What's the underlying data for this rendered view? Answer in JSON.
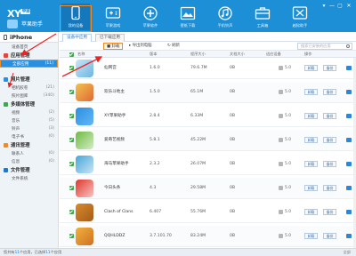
{
  "app": {
    "logo_text": "XY",
    "logo_badge": "苹果",
    "logo_subtitle": "苹果助手"
  },
  "nav": [
    {
      "label": "我的设备",
      "icon": "phone-icon",
      "active": true
    },
    {
      "label": "苹果游戏",
      "icon": "gamepad-icon"
    },
    {
      "label": "苹果软件",
      "icon": "plus-icon"
    },
    {
      "label": "壁纸下载",
      "icon": "image-icon"
    },
    {
      "label": "手机铃声",
      "icon": "bell-icon"
    },
    {
      "label": "工具箱",
      "icon": "briefcase-icon"
    },
    {
      "label": "越狱助手",
      "icon": "jailbreak-icon"
    }
  ],
  "window_controls": [
    "▾",
    "—",
    "▢",
    "✕"
  ],
  "sidebar": {
    "device": "iPhone",
    "device_sub": "设备首页",
    "sections": [
      {
        "title": "应用管理",
        "color": "#e2453c",
        "items": [
          {
            "label": "全部应用",
            "count": "(11)",
            "selected": true
          }
        ]
      },
      {
        "title": "照片管理",
        "color": "#2b8fe0",
        "items": [
          {
            "label": "相机胶卷",
            "count": "(21)"
          },
          {
            "label": "照片图库",
            "count": "(340)"
          }
        ]
      },
      {
        "title": "多媒体管理",
        "color": "#3fa84a",
        "items": [
          {
            "label": "视频",
            "count": "(2)"
          },
          {
            "label": "音乐",
            "count": "(5)"
          },
          {
            "label": "铃声",
            "count": "(3)"
          },
          {
            "label": "电子书",
            "count": "(0)"
          }
        ]
      },
      {
        "title": "通讯管理",
        "color": "#f08a24",
        "items": [
          {
            "label": "联系人",
            "count": "(0)"
          },
          {
            "label": "信息",
            "count": "(0)"
          }
        ]
      },
      {
        "title": "文件管理",
        "color": "#1d78d2",
        "items": [
          {
            "label": "文件系统",
            "count": ""
          }
        ]
      }
    ]
  },
  "main": {
    "tabs": [
      "设备中应用",
      "已下载应用"
    ],
    "toolbar": {
      "uninstall": "卸载",
      "export_backup": "导出到电脑",
      "refresh": "刷新",
      "search_placeholder": "搜索已安装的应用"
    },
    "columns": [
      "名称",
      "版本",
      "程序大小",
      "文档大小",
      "适应设备",
      "操作"
    ],
    "action_uninstall": "卸载",
    "action_backup": "备份"
  },
  "apps": [
    {
      "name": "仙网宫",
      "version": "1.6.0",
      "size": "79.6.7M",
      "doc": "0B",
      "ios": "5.0",
      "color": "#c7e6f7",
      "accent": "#4aa1d8"
    },
    {
      "name": "欢乐斗地主",
      "version": "1.5.0",
      "size": "65.1M",
      "doc": "0B",
      "ios": "5.0",
      "color": "#f2c24c",
      "accent": "#d7462f"
    },
    {
      "name": "XY苹果助手",
      "version": "2.8.4",
      "size": "6.33M",
      "doc": "0B",
      "ios": "5.0",
      "color": "#2a8fe0",
      "accent": "#7bc6ff"
    },
    {
      "name": "爱奇艺视频",
      "version": "5.8.1",
      "size": "45.22M",
      "doc": "0B",
      "ios": "5.0",
      "color": "#6dbb3f",
      "accent": "#ffffff"
    },
    {
      "name": "海马苹果助手",
      "version": "2.3.2",
      "size": "26.07M",
      "doc": "0B",
      "ios": "5.0",
      "color": "#46a6d8",
      "accent": "#ffffff"
    },
    {
      "name": "今日头条",
      "version": "4.3",
      "size": "29.58M",
      "doc": "0B",
      "ios": "5.0",
      "color": "#e0362d",
      "accent": "#ffffff"
    },
    {
      "name": "Clash of Clans",
      "version": "6.407",
      "size": "55.76M",
      "doc": "0B",
      "ios": "5.0",
      "color": "#d98a2a",
      "accent": "#8c4a17"
    },
    {
      "name": "QQHLDDZ",
      "version": "3.7.101.70",
      "size": "83.24M",
      "doc": "0B",
      "ios": "5.0",
      "color": "#f0b13c",
      "accent": "#c2571a"
    }
  ],
  "status": {
    "prefix": "您共有",
    "count_app": "11",
    "mid": "个应用，已选择",
    "count_sel": "11",
    "suffix": "个应用",
    "right": "全部"
  }
}
